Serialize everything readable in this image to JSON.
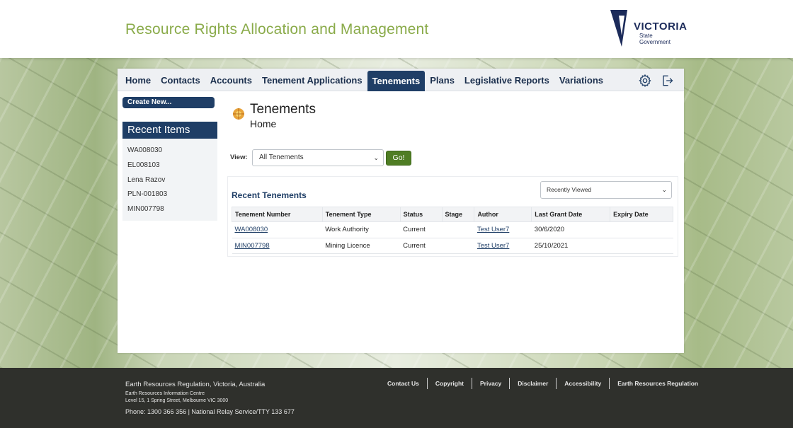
{
  "header": {
    "app_title": "Resource Rights Allocation and Management",
    "logo_name": "VICTORIA",
    "logo_sub_1": "State",
    "logo_sub_2": "Government"
  },
  "nav": {
    "items": [
      "Home",
      "Contacts",
      "Accounts",
      "Tenement Applications",
      "Tenements",
      "Plans",
      "Legislative Reports",
      "Variations"
    ],
    "active": "Tenements",
    "icons": [
      "gear-icon",
      "logout-icon"
    ]
  },
  "sidebar": {
    "create_label": "Create New...",
    "recent_title": "Recent Items",
    "recent_items": [
      "WA008030",
      "EL008103",
      "Lena Razov",
      "PLN-001803",
      "MIN007798"
    ]
  },
  "main": {
    "title": "Tenements",
    "subtitle": "Home",
    "view_label": "View:",
    "view_value": "All Tenements",
    "go_label": "Go!",
    "section_title": "Recent Tenements",
    "sort_value": "Recently Viewed",
    "table": {
      "headers": [
        "Tenement Number",
        "Tenement Type",
        "Status",
        "Stage",
        "Author",
        "Last Grant Date",
        "Expiry Date"
      ],
      "rows": [
        [
          "WA008030",
          "Work Authority",
          "Current",
          "",
          "Test User7",
          "30/6/2020",
          ""
        ],
        [
          "MIN007798",
          "Mining Licence",
          "Current",
          "",
          "Test User7",
          "25/10/2021",
          ""
        ]
      ]
    }
  },
  "footer": {
    "org": "Earth Resources Regulation, Victoria, Australia",
    "addr1": "Earth Resources Information Centre",
    "addr2": "Level 15, 1 Spring Street, Melbourne VIC 3000",
    "phone": "Phone: 1300 366 356 | National Relay Service/TTY 133 677",
    "links": [
      "Contact Us",
      "Copyright",
      "Privacy",
      "Disclaimer",
      "Accessibility",
      "Earth Resources Regulation"
    ]
  },
  "colors": {
    "brand_navy": "#1f3e66",
    "title_green": "#8aab4a",
    "go_green": "#4f7d24",
    "footer_bg": "#2f302c"
  }
}
